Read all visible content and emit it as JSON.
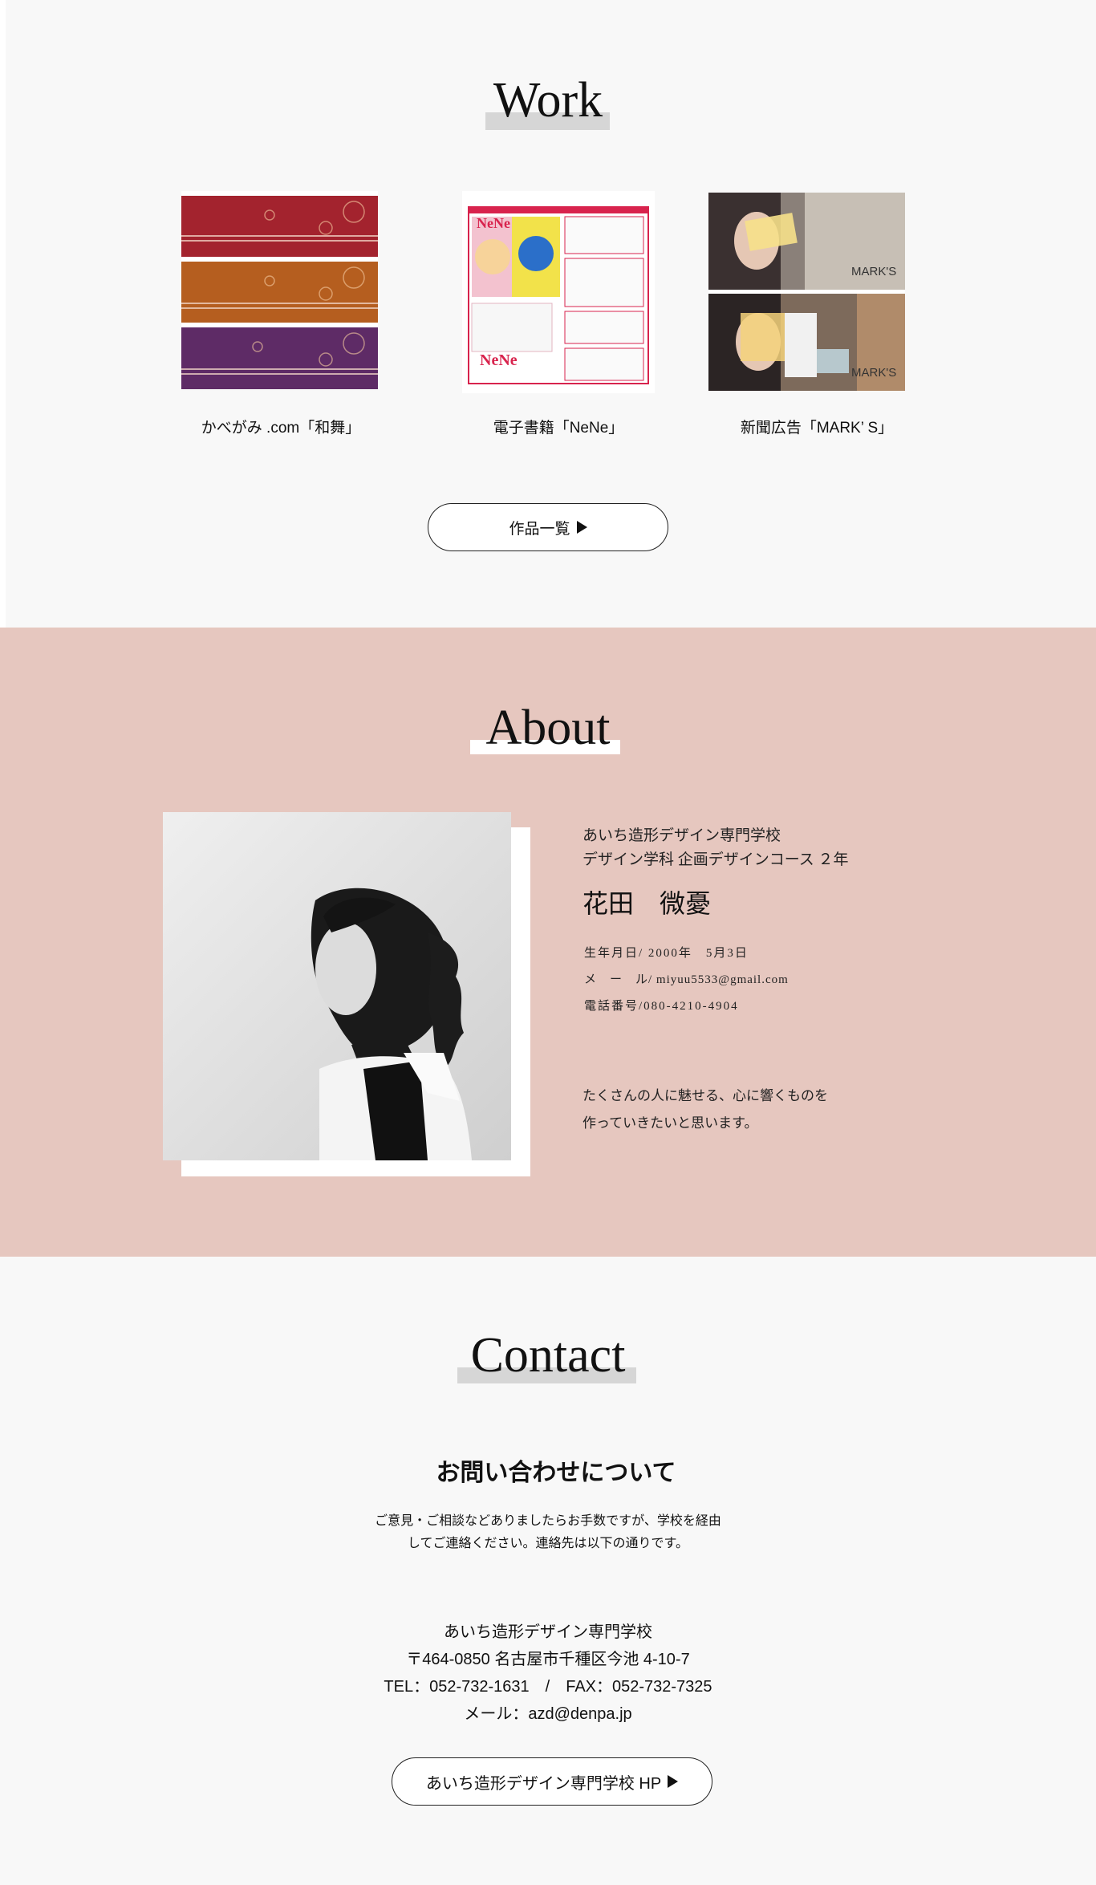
{
  "work": {
    "heading": "Work",
    "items": [
      {
        "caption": "かべがみ .com「和舞」"
      },
      {
        "caption": "電子書籍「NeNe」"
      },
      {
        "caption": "新聞広告「MARK’ S」"
      }
    ],
    "thumb_text": {
      "nene_logo": "NeNe",
      "marks_logo": "MARK'S"
    },
    "button_label": "作品一覧"
  },
  "about": {
    "heading": "About",
    "school": "あいち造形デザイン専門学校",
    "department": "デザイン学科 企画デザインコース ２年",
    "name": "花田　微憂",
    "birthday": "生年月日/ 2000年　5月3日",
    "email": "メ　ー　ル/ miyuu5533@gmail.com",
    "phone": "電話番号/080-4210-4904",
    "message_line1": "たくさんの人に魅せる、心に響くものを",
    "message_line2": "作っていきたいと思います。"
  },
  "contact": {
    "heading": "Contact",
    "subheading": "お問い合わせについて",
    "note_line1": "ご意見・ご相談などありましたらお手数ですが、学校を経由",
    "note_line2": "してご連絡ください。連絡先は以下の通りです。",
    "school": "あいち造形デザイン専門学校",
    "address": "〒464-0850 名古屋市千種区今池 4-10-7",
    "tel_fax": "TEL：052-732-1631　/　FAX：052-732-7325",
    "mail": "メール：azd@denpa.jp",
    "button_label": "あいち造形デザイン専門学校 HP"
  },
  "colors": {
    "page_bg": "#f8f8f8",
    "about_bg": "#e6c7bf",
    "heading_highlight_gray": "#d6d6d6",
    "heading_highlight_white": "#ffffff"
  }
}
